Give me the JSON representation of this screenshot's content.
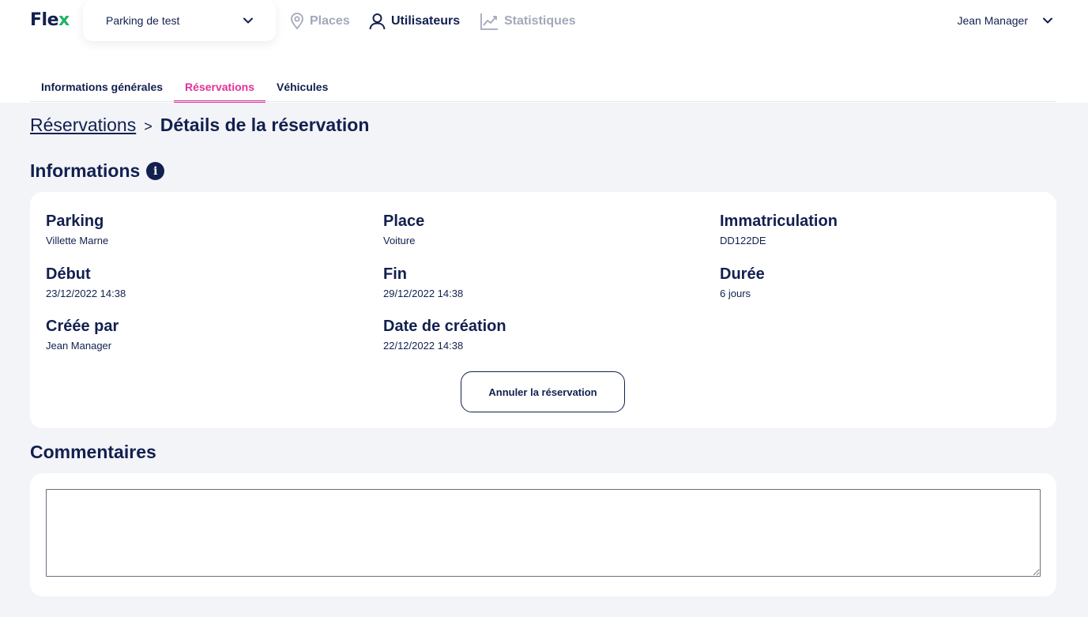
{
  "header": {
    "logo_main": "Fle",
    "logo_accent": "x",
    "parking_select": {
      "value": "Parking de test"
    },
    "nav": [
      {
        "label": "Places",
        "icon": "location-pin-icon",
        "state": "inactive"
      },
      {
        "label": "Utilisateurs",
        "icon": "user-icon",
        "state": "active"
      },
      {
        "label": "Statistiques",
        "icon": "chart-line-icon",
        "state": "inactive"
      }
    ],
    "user": {
      "name": "Jean Manager",
      "icon": "chevron-down-icon"
    }
  },
  "tabs": [
    {
      "label": "Informations générales",
      "selected": false
    },
    {
      "label": "Réservations",
      "selected": true
    },
    {
      "label": "Véhicules",
      "selected": false
    }
  ],
  "breadcrumb": {
    "parent": "Réservations",
    "separator": ">",
    "current": "Détails de la réservation"
  },
  "informations": {
    "title": "Informations",
    "icon": "info-icon",
    "fields": {
      "parking": {
        "label": "Parking",
        "value": "Villette Marne"
      },
      "place": {
        "label": "Place",
        "value": "Voiture"
      },
      "immatriculation": {
        "label": "Immatriculation",
        "value": "DD122DE"
      },
      "debut": {
        "label": "Début",
        "value": "23/12/2022 14:38"
      },
      "fin": {
        "label": "Fin",
        "value": "29/12/2022 14:38"
      },
      "duree": {
        "label": "Durée",
        "value": "6 jours"
      },
      "creee_par": {
        "label": "Créée par",
        "value": "Jean Manager"
      },
      "date_creation": {
        "label": "Date de création",
        "value": "22/12/2022 14:38"
      }
    },
    "cancel_button": "Annuler la réservation"
  },
  "commentaires": {
    "title": "Commentaires",
    "value": "",
    "placeholder": ""
  },
  "colors": {
    "primary": "#12204f",
    "accent_pink": "#e0329a",
    "logo_green": "#1fb36a",
    "inactive_nav": "#a3a8ba",
    "background": "#f3f4f8"
  }
}
